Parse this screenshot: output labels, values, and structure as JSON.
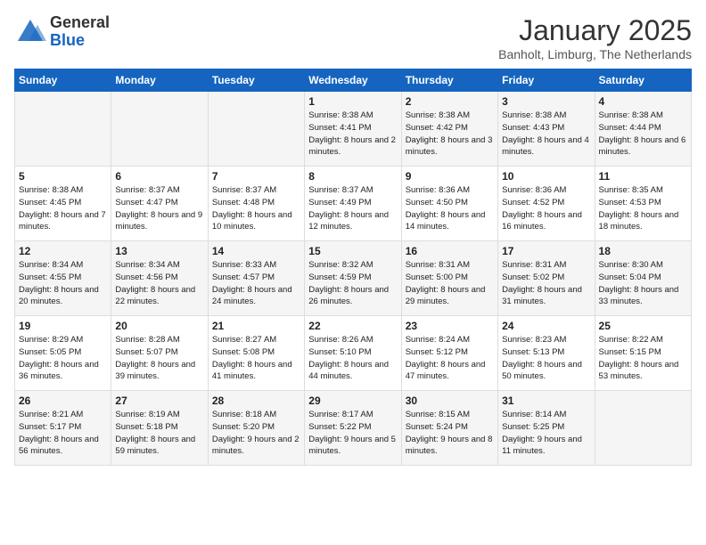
{
  "logo": {
    "general": "General",
    "blue": "Blue"
  },
  "title": "January 2025",
  "location": "Banholt, Limburg, The Netherlands",
  "days_header": [
    "Sunday",
    "Monday",
    "Tuesday",
    "Wednesday",
    "Thursday",
    "Friday",
    "Saturday"
  ],
  "weeks": [
    [
      {
        "day": "",
        "info": ""
      },
      {
        "day": "",
        "info": ""
      },
      {
        "day": "",
        "info": ""
      },
      {
        "day": "1",
        "info": "Sunrise: 8:38 AM\nSunset: 4:41 PM\nDaylight: 8 hours and 2 minutes."
      },
      {
        "day": "2",
        "info": "Sunrise: 8:38 AM\nSunset: 4:42 PM\nDaylight: 8 hours and 3 minutes."
      },
      {
        "day": "3",
        "info": "Sunrise: 8:38 AM\nSunset: 4:43 PM\nDaylight: 8 hours and 4 minutes."
      },
      {
        "day": "4",
        "info": "Sunrise: 8:38 AM\nSunset: 4:44 PM\nDaylight: 8 hours and 6 minutes."
      }
    ],
    [
      {
        "day": "5",
        "info": "Sunrise: 8:38 AM\nSunset: 4:45 PM\nDaylight: 8 hours and 7 minutes."
      },
      {
        "day": "6",
        "info": "Sunrise: 8:37 AM\nSunset: 4:47 PM\nDaylight: 8 hours and 9 minutes."
      },
      {
        "day": "7",
        "info": "Sunrise: 8:37 AM\nSunset: 4:48 PM\nDaylight: 8 hours and 10 minutes."
      },
      {
        "day": "8",
        "info": "Sunrise: 8:37 AM\nSunset: 4:49 PM\nDaylight: 8 hours and 12 minutes."
      },
      {
        "day": "9",
        "info": "Sunrise: 8:36 AM\nSunset: 4:50 PM\nDaylight: 8 hours and 14 minutes."
      },
      {
        "day": "10",
        "info": "Sunrise: 8:36 AM\nSunset: 4:52 PM\nDaylight: 8 hours and 16 minutes."
      },
      {
        "day": "11",
        "info": "Sunrise: 8:35 AM\nSunset: 4:53 PM\nDaylight: 8 hours and 18 minutes."
      }
    ],
    [
      {
        "day": "12",
        "info": "Sunrise: 8:34 AM\nSunset: 4:55 PM\nDaylight: 8 hours and 20 minutes."
      },
      {
        "day": "13",
        "info": "Sunrise: 8:34 AM\nSunset: 4:56 PM\nDaylight: 8 hours and 22 minutes."
      },
      {
        "day": "14",
        "info": "Sunrise: 8:33 AM\nSunset: 4:57 PM\nDaylight: 8 hours and 24 minutes."
      },
      {
        "day": "15",
        "info": "Sunrise: 8:32 AM\nSunset: 4:59 PM\nDaylight: 8 hours and 26 minutes."
      },
      {
        "day": "16",
        "info": "Sunrise: 8:31 AM\nSunset: 5:00 PM\nDaylight: 8 hours and 29 minutes."
      },
      {
        "day": "17",
        "info": "Sunrise: 8:31 AM\nSunset: 5:02 PM\nDaylight: 8 hours and 31 minutes."
      },
      {
        "day": "18",
        "info": "Sunrise: 8:30 AM\nSunset: 5:04 PM\nDaylight: 8 hours and 33 minutes."
      }
    ],
    [
      {
        "day": "19",
        "info": "Sunrise: 8:29 AM\nSunset: 5:05 PM\nDaylight: 8 hours and 36 minutes."
      },
      {
        "day": "20",
        "info": "Sunrise: 8:28 AM\nSunset: 5:07 PM\nDaylight: 8 hours and 39 minutes."
      },
      {
        "day": "21",
        "info": "Sunrise: 8:27 AM\nSunset: 5:08 PM\nDaylight: 8 hours and 41 minutes."
      },
      {
        "day": "22",
        "info": "Sunrise: 8:26 AM\nSunset: 5:10 PM\nDaylight: 8 hours and 44 minutes."
      },
      {
        "day": "23",
        "info": "Sunrise: 8:24 AM\nSunset: 5:12 PM\nDaylight: 8 hours and 47 minutes."
      },
      {
        "day": "24",
        "info": "Sunrise: 8:23 AM\nSunset: 5:13 PM\nDaylight: 8 hours and 50 minutes."
      },
      {
        "day": "25",
        "info": "Sunrise: 8:22 AM\nSunset: 5:15 PM\nDaylight: 8 hours and 53 minutes."
      }
    ],
    [
      {
        "day": "26",
        "info": "Sunrise: 8:21 AM\nSunset: 5:17 PM\nDaylight: 8 hours and 56 minutes."
      },
      {
        "day": "27",
        "info": "Sunrise: 8:19 AM\nSunset: 5:18 PM\nDaylight: 8 hours and 59 minutes."
      },
      {
        "day": "28",
        "info": "Sunrise: 8:18 AM\nSunset: 5:20 PM\nDaylight: 9 hours and 2 minutes."
      },
      {
        "day": "29",
        "info": "Sunrise: 8:17 AM\nSunset: 5:22 PM\nDaylight: 9 hours and 5 minutes."
      },
      {
        "day": "30",
        "info": "Sunrise: 8:15 AM\nSunset: 5:24 PM\nDaylight: 9 hours and 8 minutes."
      },
      {
        "day": "31",
        "info": "Sunrise: 8:14 AM\nSunset: 5:25 PM\nDaylight: 9 hours and 11 minutes."
      },
      {
        "day": "",
        "info": ""
      }
    ]
  ]
}
